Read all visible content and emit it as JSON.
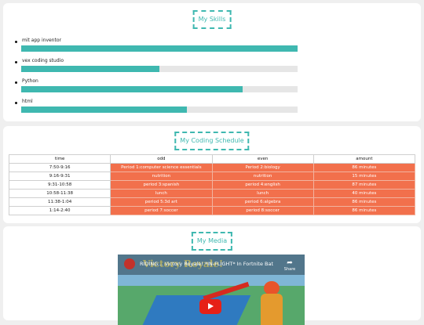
{
  "skills_section": {
    "title": "My Skills",
    "items": [
      {
        "label": "mit app inventor",
        "level": 1.0
      },
      {
        "label": "vex coding studio",
        "level": 0.5
      },
      {
        "label": "Python",
        "level": 0.8
      },
      {
        "label": "html",
        "level": 0.6
      }
    ],
    "bar_color": "#3fb8b0",
    "track_color": "#e6e6e6"
  },
  "schedule_section": {
    "title": "My Coding Schedule",
    "headers": [
      "time",
      "odd",
      "even",
      "amount"
    ],
    "rows": [
      [
        "7:50-9:16",
        "Period 1:computer science essentials",
        "Period 2:biology",
        "86 minutes"
      ],
      [
        "9:16-9:31",
        "nutrition",
        "nutrition",
        "15 minutes"
      ],
      [
        "9:31-10:58",
        "period 3:spanish",
        "period 4:english",
        "87 minutes"
      ],
      [
        "10:58-11:38",
        "lunch",
        "lunch",
        "40 minutes"
      ],
      [
        "11:38-1:04",
        "period 5:3d art",
        "period 6:algebra",
        "86 minutes"
      ],
      [
        "1:14-2:40",
        "period 7:soccer",
        "period 8:soccer",
        "86 minutes"
      ]
    ],
    "highlight_color": "#f2704c"
  },
  "media_section": {
    "title": "My Media",
    "video": {
      "title": "RIDING... Victory Royale! *IN-FLIGHT* In Fortnite Battl...",
      "overlay_text": "Victory Royale!",
      "share_label": "Share",
      "icons": [
        "channel-avatar-icon",
        "share-icon",
        "play-icon"
      ]
    }
  },
  "colors": {
    "accent": "#3fb8b0",
    "table_highlight": "#f2704c",
    "page_background": "#efefef",
    "card_background": "#ffffff"
  }
}
